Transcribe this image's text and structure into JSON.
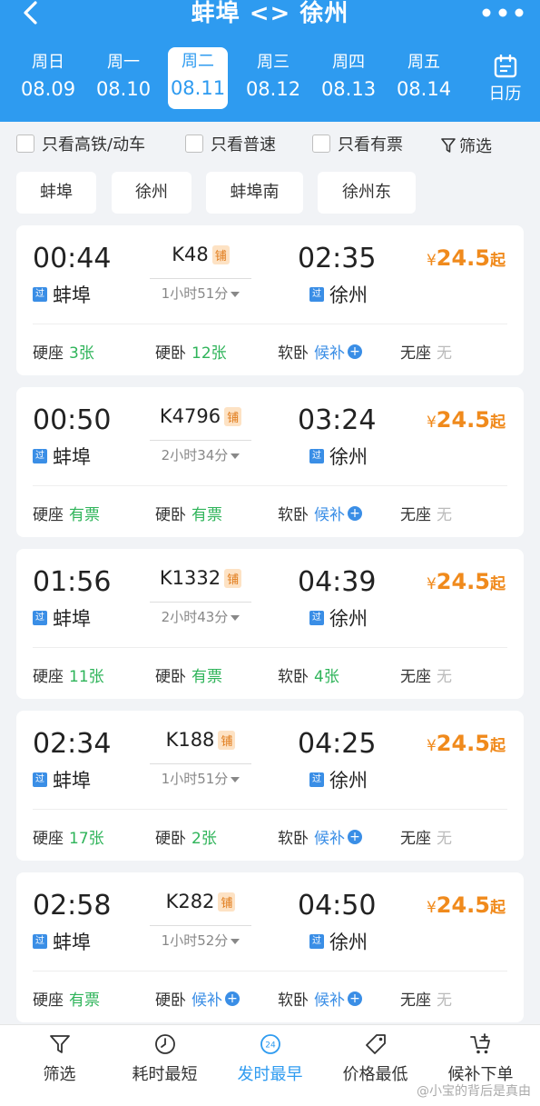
{
  "header": {
    "title": "蚌埠 <> 徐州",
    "dates": [
      {
        "weekday": "周日",
        "date": "08.09"
      },
      {
        "weekday": "周一",
        "date": "08.10"
      },
      {
        "weekday": "周二",
        "date": "08.11",
        "active": true
      },
      {
        "weekday": "周三",
        "date": "08.12"
      },
      {
        "weekday": "周四",
        "date": "08.13"
      },
      {
        "weekday": "周五",
        "date": "08.14"
      }
    ],
    "calendar_label": "日历"
  },
  "filters": {
    "high_speed": "只看高铁/动车",
    "normal": "只看普速",
    "available": "只看有票",
    "filter": "筛选"
  },
  "stations": [
    "蚌埠",
    "徐州",
    "蚌埠南",
    "徐州东"
  ],
  "trains": [
    {
      "dep_time": "00:44",
      "arr_time": "02:35",
      "train_no": "K48",
      "berth": "铺",
      "dep_station": "蚌埠",
      "arr_station": "徐州",
      "pass_dep": "过",
      "pass_arr": "过",
      "duration": "1小时51分",
      "price_yen": "¥",
      "price": "24.5",
      "price_suffix": "起",
      "seats": [
        {
          "type": "硬座",
          "status": "3张"
        },
        {
          "type": "硬卧",
          "status": "12张"
        },
        {
          "type": "软卧",
          "status": "候补"
        },
        {
          "type": "无座",
          "status": "无"
        }
      ]
    },
    {
      "dep_time": "00:50",
      "arr_time": "03:24",
      "train_no": "K4796",
      "berth": "铺",
      "dep_station": "蚌埠",
      "arr_station": "徐州",
      "pass_dep": "过",
      "pass_arr": "过",
      "duration": "2小时34分",
      "price_yen": "¥",
      "price": "24.5",
      "price_suffix": "起",
      "seats": [
        {
          "type": "硬座",
          "status": "有票"
        },
        {
          "type": "硬卧",
          "status": "有票"
        },
        {
          "type": "软卧",
          "status": "候补"
        },
        {
          "type": "无座",
          "status": "无"
        }
      ]
    },
    {
      "dep_time": "01:56",
      "arr_time": "04:39",
      "train_no": "K1332",
      "berth": "铺",
      "dep_station": "蚌埠",
      "arr_station": "徐州",
      "pass_dep": "过",
      "pass_arr": "过",
      "duration": "2小时43分",
      "price_yen": "¥",
      "price": "24.5",
      "price_suffix": "起",
      "seats": [
        {
          "type": "硬座",
          "status": "11张"
        },
        {
          "type": "硬卧",
          "status": "有票"
        },
        {
          "type": "软卧",
          "status": "4张"
        },
        {
          "type": "无座",
          "status": "无"
        }
      ]
    },
    {
      "dep_time": "02:34",
      "arr_time": "04:25",
      "train_no": "K188",
      "berth": "铺",
      "dep_station": "蚌埠",
      "arr_station": "徐州",
      "pass_dep": "过",
      "pass_arr": "过",
      "duration": "1小时51分",
      "price_yen": "¥",
      "price": "24.5",
      "price_suffix": "起",
      "seats": [
        {
          "type": "硬座",
          "status": "17张"
        },
        {
          "type": "硬卧",
          "status": "2张"
        },
        {
          "type": "软卧",
          "status": "候补"
        },
        {
          "type": "无座",
          "status": "无"
        }
      ]
    },
    {
      "dep_time": "02:58",
      "arr_time": "04:50",
      "train_no": "K282",
      "berth": "铺",
      "dep_station": "蚌埠",
      "arr_station": "徐州",
      "pass_dep": "过",
      "pass_arr": "过",
      "duration": "1小时52分",
      "price_yen": "¥",
      "price": "24.5",
      "price_suffix": "起",
      "seats": [
        {
          "type": "硬座",
          "status": "有票"
        },
        {
          "type": "硬卧",
          "status": "候补"
        },
        {
          "type": "软卧",
          "status": "候补"
        },
        {
          "type": "无座",
          "status": "无"
        }
      ]
    }
  ],
  "bottom": {
    "filter": "筛选",
    "shortest": "耗时最短",
    "earliest": "发时最早",
    "earliest_badge": "24",
    "cheapest": "价格最低",
    "waitlist": "候补下单"
  },
  "watermark": "@小宝的背后是真由",
  "colors": {
    "brand": "#2e9bf0",
    "price": "#f08a1c",
    "available": "#2fb45a",
    "waitlist": "#3a8ee6",
    "none": "#bbbbbb"
  }
}
